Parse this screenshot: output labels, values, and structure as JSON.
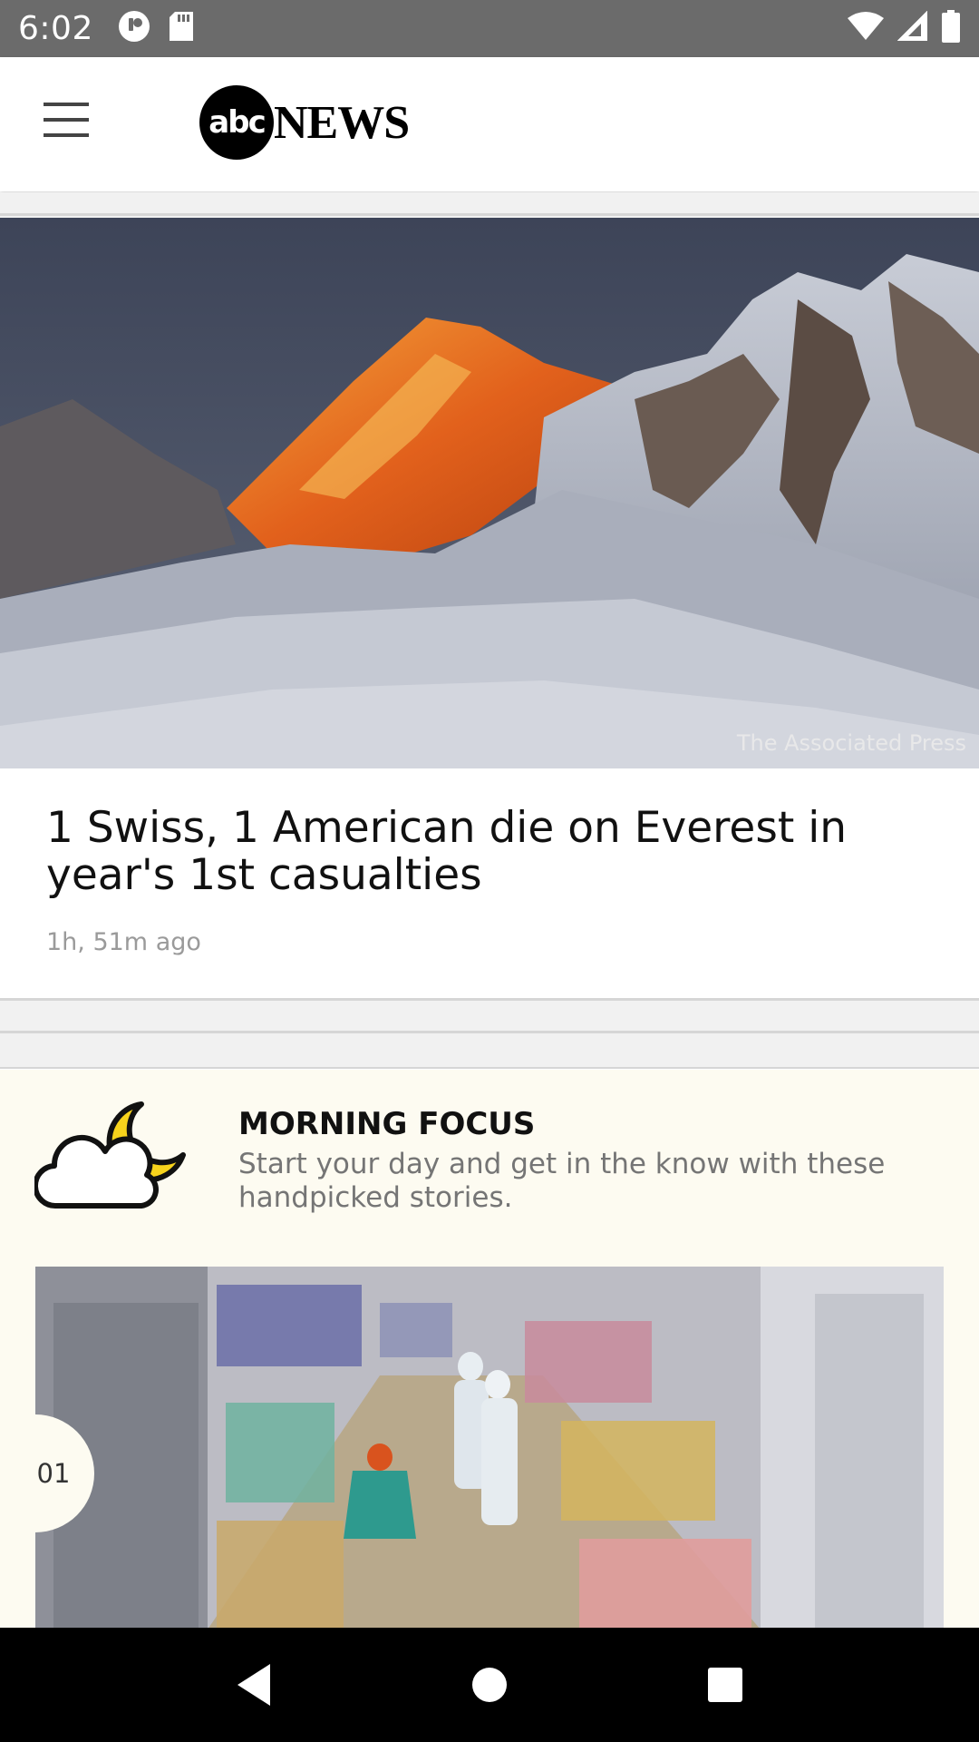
{
  "status_bar": {
    "time": "6:02",
    "left_icons": [
      "vpn-key-icon",
      "sd-card-icon"
    ],
    "right_icons": [
      "wifi-icon",
      "signal-icon",
      "battery-icon"
    ]
  },
  "app_bar": {
    "logo_circle_text": "abc",
    "logo_text": "NEWS",
    "menu_icon": "hamburger-menu-icon"
  },
  "top_story": {
    "image_credit": "The Associated Press",
    "headline": "1 Swiss, 1 American die on Everest in year's 1st casualties",
    "timestamp": "1h, 51m ago"
  },
  "morning_focus": {
    "icon": "cloud-moon-icon",
    "title": "MORNING FOCUS",
    "description": "Start your day and get in the know with these handpicked stories.",
    "first_item_index": "01"
  },
  "nav_bar": {
    "back_icon": "back-triangle-icon",
    "home_icon": "home-circle-icon",
    "recents_icon": "recents-square-icon"
  },
  "colors": {
    "status_bar_bg": "#6b6b6b",
    "focus_bg": "#fdfbf1",
    "moon_yellow": "#f7d31c"
  }
}
